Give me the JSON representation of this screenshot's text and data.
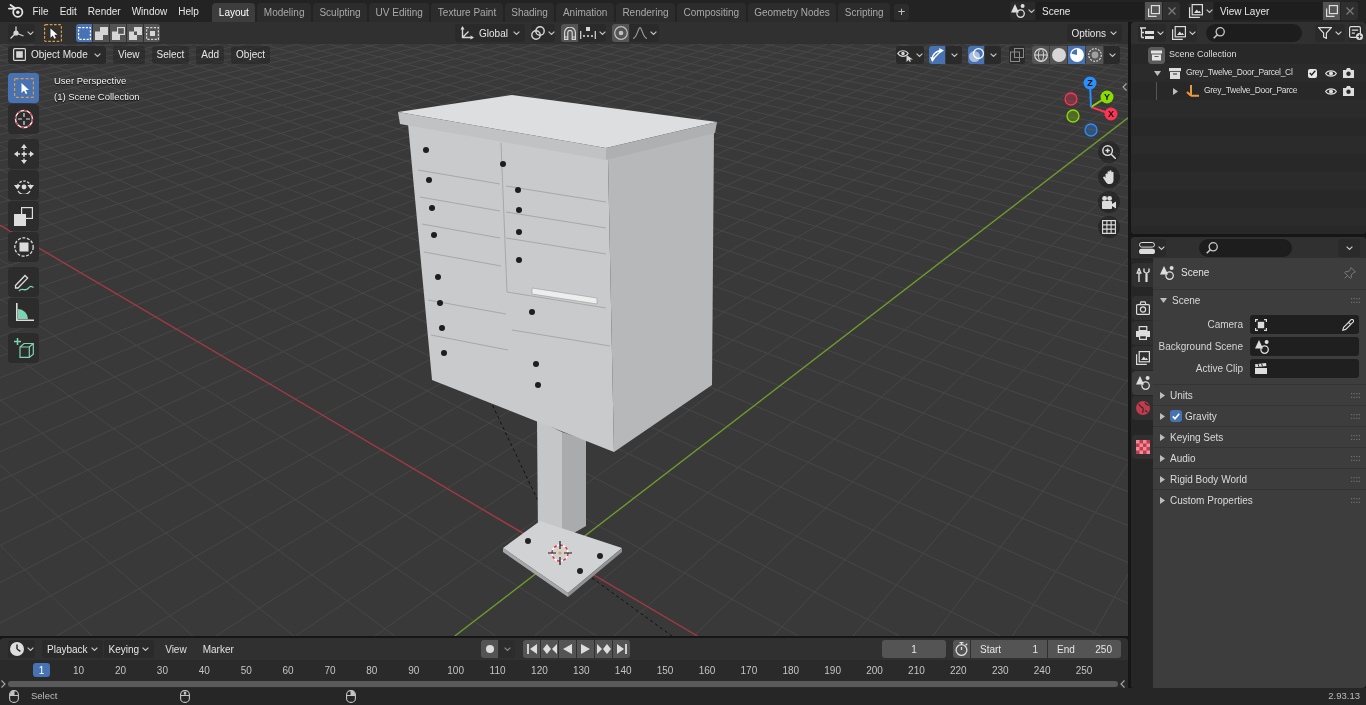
{
  "top_bar": {
    "menus": [
      "File",
      "Edit",
      "Render",
      "Window",
      "Help"
    ],
    "workspaces": [
      {
        "label": "Layout",
        "selected": true
      },
      {
        "label": "Modeling",
        "selected": false
      },
      {
        "label": "Sculpting",
        "selected": false
      },
      {
        "label": "UV Editing",
        "selected": false
      },
      {
        "label": "Texture Paint",
        "selected": false
      },
      {
        "label": "Shading",
        "selected": false
      },
      {
        "label": "Animation",
        "selected": false
      },
      {
        "label": "Rendering",
        "selected": false
      },
      {
        "label": "Compositing",
        "selected": false
      },
      {
        "label": "Geometry Nodes",
        "selected": false
      },
      {
        "label": "Scripting",
        "selected": false
      }
    ],
    "add_workspace": "+",
    "scene": "Scene",
    "view_layer": "View Layer"
  },
  "viewport": {
    "tool_header": {
      "select_modes": [
        {
          "selected": true
        },
        {
          "selected": false
        },
        {
          "selected": false
        },
        {
          "selected": false
        },
        {
          "selected": false
        }
      ],
      "orientation": "Global",
      "snap": {
        "on": false
      },
      "proportional_editing": {
        "on": false
      },
      "options": "Options"
    },
    "header": {
      "mode": "Object Mode",
      "menus": [
        "View",
        "Select",
        "Add",
        "Object"
      ],
      "gizmos": {
        "on": true
      },
      "overlays": {
        "on": true
      },
      "xray": {
        "on": false
      },
      "shading_modes": [
        {
          "selected": false
        },
        {
          "selected": false
        },
        {
          "selected": true
        },
        {
          "selected": false
        }
      ]
    },
    "toolbar": {
      "groups": [
        {
          "tools": [
            {
              "selected": true
            },
            {
              "selected": false
            }
          ]
        },
        {
          "tools": [
            {
              "selected": false
            },
            {
              "selected": false
            },
            {
              "selected": false
            },
            {
              "selected": false
            }
          ]
        },
        {
          "tools": [
            {
              "selected": false
            },
            {
              "selected": false
            }
          ]
        },
        {
          "tools": [
            {
              "selected": false
            }
          ]
        }
      ]
    },
    "view_info": [
      "User Perspective",
      "(1) Scene Collection"
    ],
    "navigation_gizmo": {
      "axes": [
        "X",
        "Y",
        "Z"
      ]
    }
  },
  "timeline": {
    "menus": [
      {
        "label": "Playback",
        "kind": "dropdown"
      },
      {
        "label": "Keying",
        "kind": "dropdown"
      },
      {
        "label": "View",
        "kind": "menu"
      },
      {
        "label": "Marker",
        "kind": "menu"
      }
    ],
    "auto_keying": {
      "on": false
    },
    "current_frame": "1",
    "start": {
      "label": "Start",
      "value": "1"
    },
    "end": {
      "label": "End",
      "value": "250"
    },
    "ruler": {
      "playhead": "1",
      "ticks": [
        "10",
        "20",
        "30",
        "40",
        "50",
        "60",
        "70",
        "80",
        "90",
        "100",
        "110",
        "120",
        "130",
        "140",
        "150",
        "160",
        "170",
        "180",
        "190",
        "200",
        "210",
        "220",
        "230",
        "240",
        "250"
      ]
    }
  },
  "outliner": {
    "root": "Scene Collection",
    "items": [
      {
        "label": "Grey_Twelve_Door_Parcel_Cl",
        "expanded": true,
        "checkbox": {
          "checked": true
        },
        "visible": true,
        "renderable": true,
        "children": [
          {
            "label": "Grey_Twelve_Door_Parce",
            "expanded": false,
            "visible": true,
            "renderable": true
          }
        ]
      }
    ]
  },
  "properties": {
    "tab_groups": [
      {
        "tabs": [
          {
            "selected": false
          }
        ]
      },
      {
        "tabs": [
          {
            "selected": false
          },
          {
            "selected": false
          },
          {
            "selected": false
          },
          {
            "selected": true
          },
          {
            "selected": false
          }
        ]
      },
      {
        "tabs": [
          {
            "selected": false
          }
        ]
      }
    ],
    "context": "Scene",
    "panels": [
      {
        "title": "Scene",
        "expanded": true,
        "fields": [
          {
            "label": "Camera",
            "kind": "camera"
          },
          {
            "label": "Background Scene",
            "kind": "scene"
          },
          {
            "label": "Active Clip",
            "kind": "clip"
          }
        ]
      },
      {
        "title": "Units",
        "expanded": false
      },
      {
        "title": "Gravity",
        "expanded": false,
        "checkbox": {
          "checked": true
        }
      },
      {
        "title": "Keying Sets",
        "expanded": false
      },
      {
        "title": "Audio",
        "expanded": false
      },
      {
        "title": "Rigid Body World",
        "expanded": false
      },
      {
        "title": "Custom Properties",
        "expanded": false
      }
    ]
  },
  "status_bar": {
    "hint": "Select",
    "version": "2.93.13"
  }
}
